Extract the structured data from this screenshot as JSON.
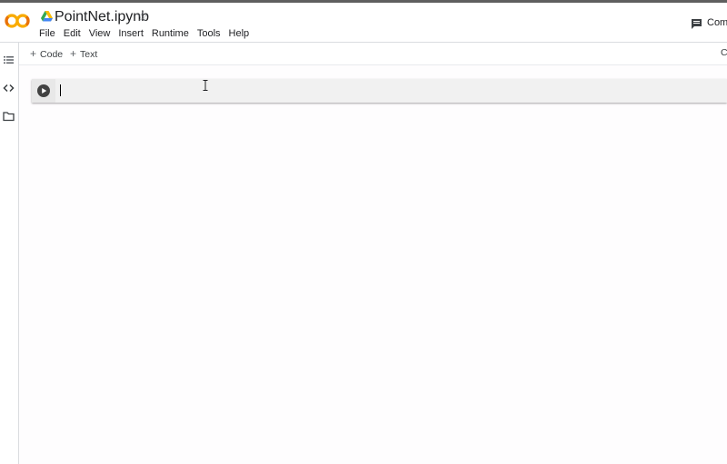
{
  "notebook": {
    "title": "PointNet.ipynb"
  },
  "menu": [
    "File",
    "Edit",
    "View",
    "Insert",
    "Runtime",
    "Tools",
    "Help"
  ],
  "header": {
    "comment_label": "Comm"
  },
  "toolbar": {
    "add_code": "Code",
    "add_text": "Text",
    "right_label": "C"
  },
  "cell": {
    "code": ""
  },
  "icons": {
    "logo": "colab-logo",
    "drive": "google-drive-icon",
    "star": "star-outline-icon",
    "comment": "comment-icon",
    "toc": "table-of-contents-icon",
    "snippets": "code-snippets-icon",
    "files": "folder-icon",
    "run": "play-icon"
  },
  "colors": {
    "logo_orange": "#f9ab00",
    "logo_dark_orange": "#e8710a",
    "run_button": "#424242"
  }
}
